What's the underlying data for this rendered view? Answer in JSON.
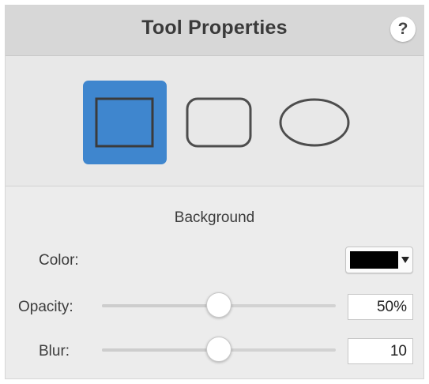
{
  "panel": {
    "title": "Tool Properties",
    "help_label": "?"
  },
  "shape_tools": [
    {
      "name": "rectangle",
      "icon": "rectangle-icon",
      "selected": true
    },
    {
      "name": "rounded-rectangle",
      "icon": "rounded-rectangle-icon",
      "selected": false
    },
    {
      "name": "ellipse",
      "icon": "ellipse-icon",
      "selected": false
    }
  ],
  "background": {
    "section_title": "Background",
    "color": {
      "label": "Color:",
      "value": "#000000",
      "icon": "dropdown-arrow-icon"
    },
    "opacity": {
      "label": "Opacity:",
      "slider_fraction": 0.5,
      "value": "50%"
    },
    "blur": {
      "label": "Blur:",
      "slider_fraction": 0.5,
      "value": "10"
    }
  },
  "colors": {
    "accent": "#3f86ce",
    "header_bg": "#d7d7d7",
    "panel_bg": "#ececec"
  }
}
